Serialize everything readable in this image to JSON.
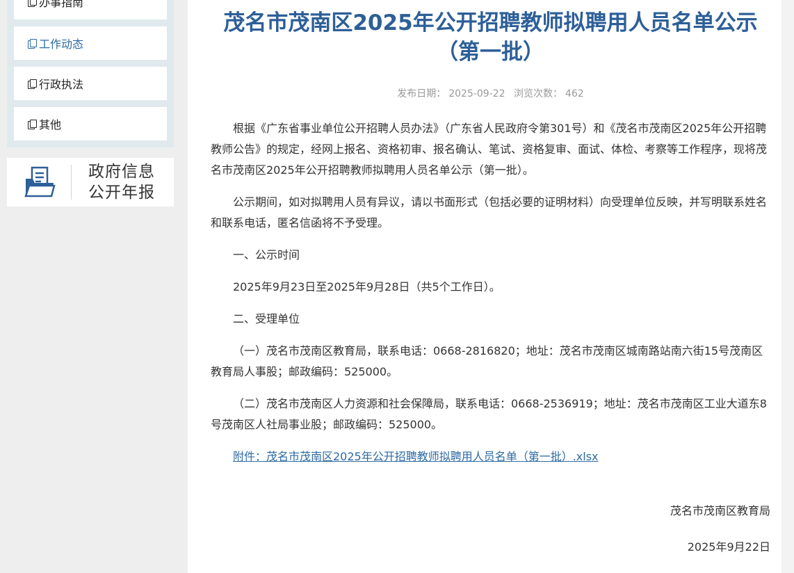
{
  "sidebar": {
    "items": [
      {
        "label": "办事指南"
      },
      {
        "label": "工作动态"
      },
      {
        "label": "行政执法"
      },
      {
        "label": "其他"
      }
    ],
    "annual_report": {
      "line1": "政府信息",
      "line2": "公开年报"
    }
  },
  "article": {
    "title": "茂名市茂南区2025年公开招聘教师拟聘用人员名单公示（第一批）",
    "meta": {
      "publish_label": "发布日期：",
      "publish_date": "2025-09-22",
      "views_label": "浏览次数：",
      "views": "462"
    },
    "paragraphs": [
      "根据《广东省事业单位公开招聘人员办法》（广东省人民政府令第301号）和《茂名市茂南区2025年公开招聘教师公告》的规定，经网上报名、资格初审、报名确认、笔试、资格复审、面试、体检、考察等工作程序，现将茂名市茂南区2025年公开招聘教师拟聘用人员名单公示（第一批）。",
      "公示期间，如对拟聘用人员有异议，请以书面形式（包括必要的证明材料）向受理单位反映，并写明联系姓名和联系电话，匿名信函将不予受理。",
      "一、公示时间",
      "2025年9月23日至2025年9月28日（共5个工作日）。",
      "二、受理单位",
      "（一）茂名市茂南区教育局，联系电话：0668-2816820；地址：茂名市茂南区城南路站南六街15号茂南区教育局人事股；邮政编码：525000。",
      "（二）茂名市茂南区人力资源和社会保障局，联系电话：0668-2536919；地址：茂名市茂南区工业大道东8号茂南区人社局事业股；邮政编码：525000。"
    ],
    "attachment": "附件：茂名市茂南区2025年公开招聘教师拟聘用人员名单（第一批）.xlsx",
    "signature": {
      "org": "茂名市茂南区教育局",
      "date": "2025年9月22日"
    }
  },
  "colors": {
    "title": "#2d5f98",
    "link": "#2c6aa3",
    "sidebar_bg": "#dfe9ee"
  }
}
